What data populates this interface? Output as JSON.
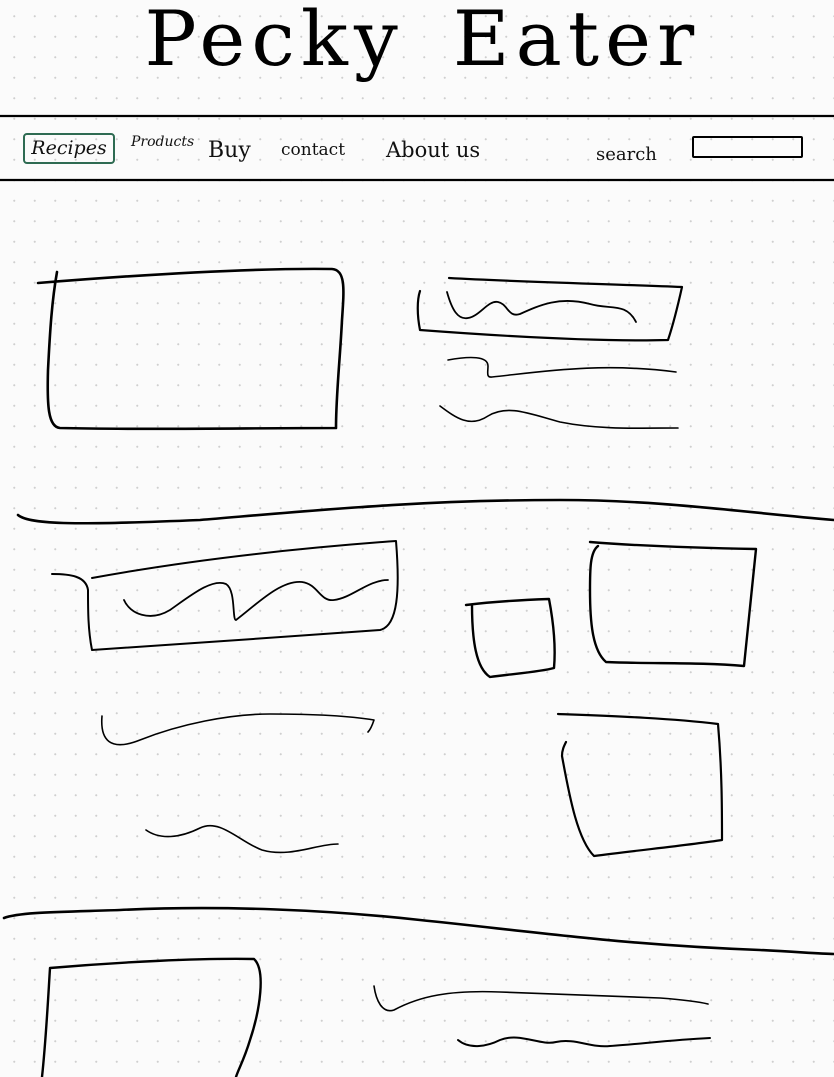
{
  "header": {
    "brand": {
      "word1": "Pecky",
      "word2": "Eater"
    }
  },
  "nav": {
    "items": [
      {
        "label": "Recipes",
        "active": true
      },
      {
        "label": "Products",
        "active": false
      },
      {
        "label": "Buy",
        "active": false
      },
      {
        "label": "contact",
        "active": false
      },
      {
        "label": "About us",
        "active": false
      }
    ],
    "search": {
      "label": "search",
      "value": "",
      "placeholder": ""
    }
  },
  "colors": {
    "ink": "#000000",
    "active_tab_border": "#2e6b52",
    "paper": "#fbfbfb",
    "dot_grid": "#cfcfcf"
  }
}
